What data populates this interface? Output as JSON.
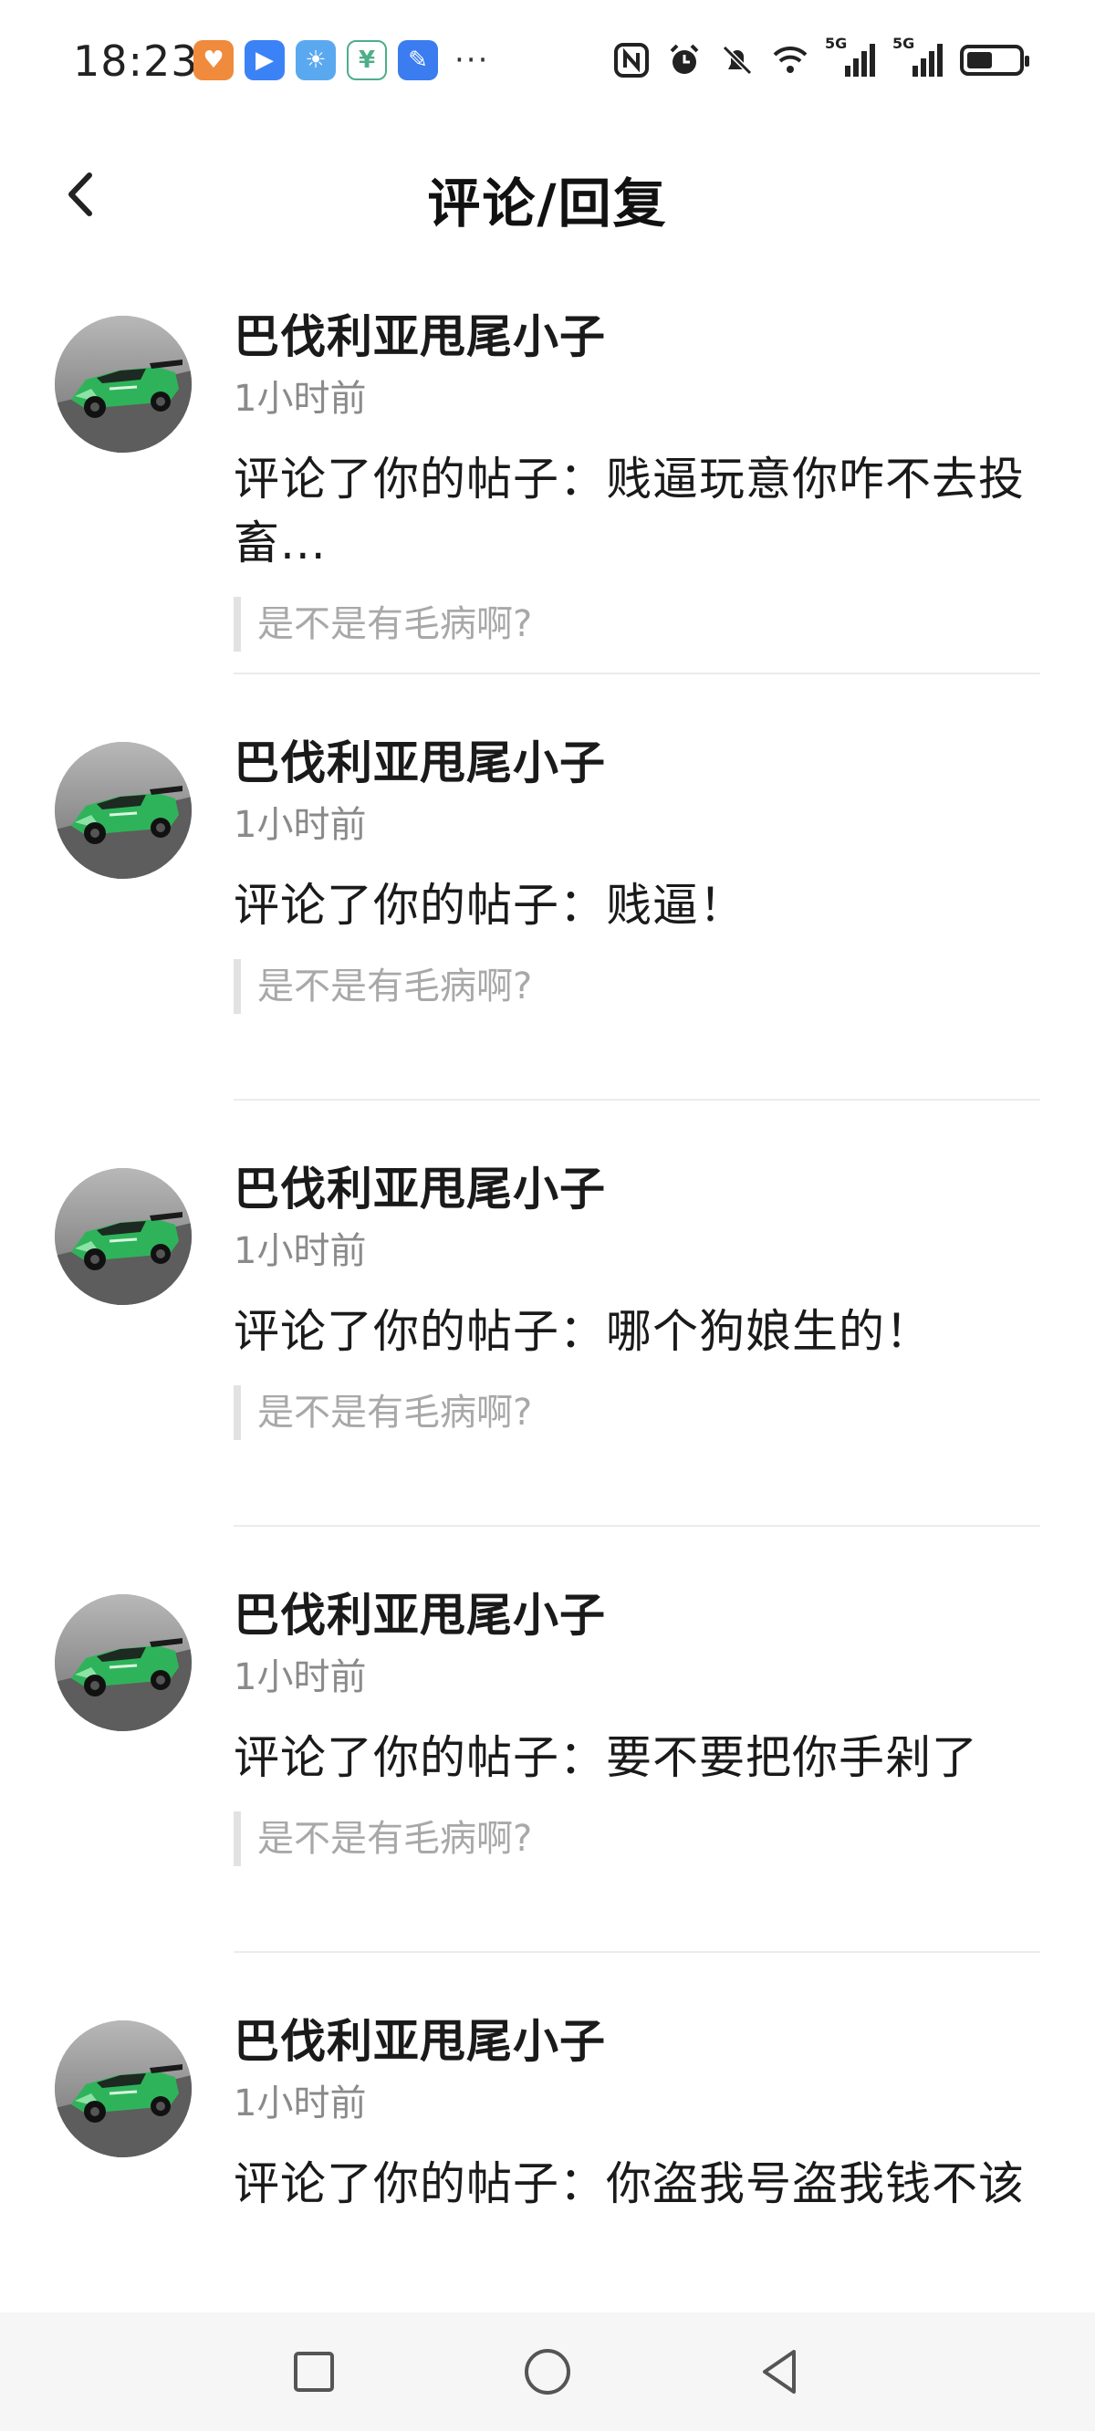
{
  "status_bar": {
    "time": "18:23",
    "more": "···",
    "network_1": "5G",
    "network_2": "5G",
    "battery_level": 0.5,
    "app_icons": [
      {
        "name": "shopping-app-icon",
        "color": "#f08a3c"
      },
      {
        "name": "play-app-icon",
        "color": "#3b82f6"
      },
      {
        "name": "weather-app-icon",
        "color": "#5aa9f0"
      },
      {
        "name": "finance-app-icon",
        "color": "#4caf8a"
      },
      {
        "name": "broom-app-icon",
        "color": "#3b7cf0"
      }
    ]
  },
  "header": {
    "title": "评论/回复"
  },
  "items": [
    {
      "username": "巴伐利亚甩尾小子",
      "time": "1小时前",
      "comment": "评论了你的帖子：贱逼玩意你咋不去投畜...",
      "quote": "是不是有毛病啊?"
    },
    {
      "username": "巴伐利亚甩尾小子",
      "time": "1小时前",
      "comment": "评论了你的帖子：贱逼！",
      "quote": "是不是有毛病啊?"
    },
    {
      "username": "巴伐利亚甩尾小子",
      "time": "1小时前",
      "comment": "评论了你的帖子：哪个狗娘生的！",
      "quote": "是不是有毛病啊?"
    },
    {
      "username": "巴伐利亚甩尾小子",
      "time": "1小时前",
      "comment": "评论了你的帖子：要不要把你手剁了",
      "quote": "是不是有毛病啊?"
    },
    {
      "username": "巴伐利亚甩尾小子",
      "time": "1小时前",
      "comment": "评论了你的帖子：你盗我号盗我钱不该",
      "quote": ""
    }
  ],
  "colors": {
    "text": "#1a1a1a",
    "secondary": "#8a8a8a",
    "quote": "#a8a8a8",
    "car_green": "#2fb35a"
  }
}
